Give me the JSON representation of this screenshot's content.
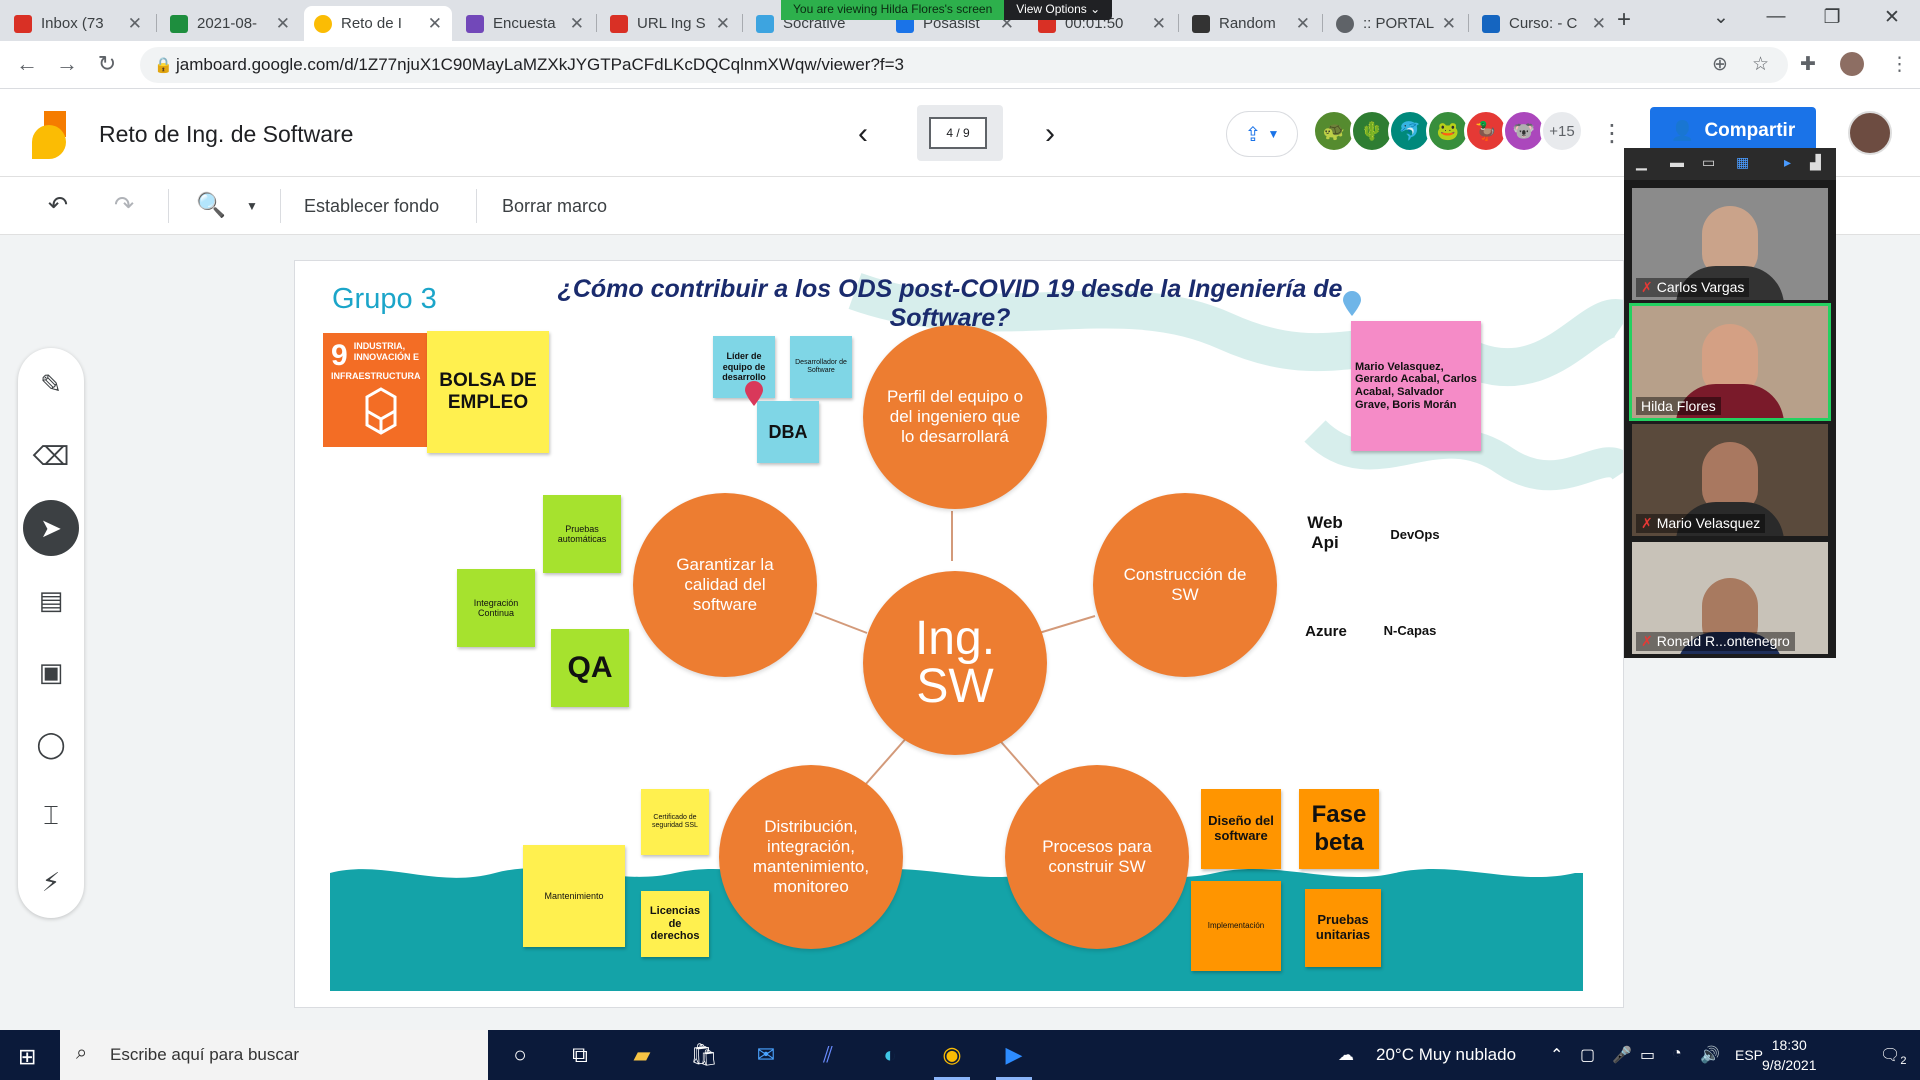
{
  "browser": {
    "tabs": [
      {
        "title": "Inbox (73",
        "color": "#d93025"
      },
      {
        "title": "2021-08-",
        "color": "#1e8e3e"
      },
      {
        "title": "Reto de I",
        "color": "#fbbc04"
      },
      {
        "title": "Encuesta",
        "color": "#7248b9"
      },
      {
        "title": "URL Ing S",
        "color": "#d93025"
      },
      {
        "title": "Socrative",
        "color": "#3da4e0"
      },
      {
        "title": "Posasist",
        "color": "#1a73e8"
      },
      {
        "title": "00:01:50",
        "color": "#d93025"
      },
      {
        "title": "Random",
        "color": "#333333"
      },
      {
        "title": ":: PORTAL",
        "color": "#5f6368"
      },
      {
        "title": "Curso: - C",
        "color": "#1565c0"
      }
    ],
    "screen_share_notice": "You are viewing Hilda Flores's screen",
    "view_options": "View Options",
    "url": "jamboard.google.com/d/1Z77njuX1C90MayLaMZXkJYGTPaCFdLKcDQCqlnmXWqw/viewer?f=3"
  },
  "app": {
    "title": "Reto de Ing. de Software",
    "frame_indicator": "4 / 9",
    "collaborators_more": "+15",
    "share_label": "Compartir",
    "accent": "#1a73e8"
  },
  "toolbar": {
    "set_background": "Establecer fondo",
    "clear_frame": "Borrar marco"
  },
  "canvas": {
    "title": "¿Cómo contribuir a los ODS post-COVID 19 desde la Ingeniería de Software?",
    "group": "Grupo 3",
    "sdg": {
      "number": "9",
      "label": "INDUSTRIA, INNOVACIÓN E INFRAESTRUCTURA"
    },
    "center": "Ing. SW",
    "circles": {
      "perfil": "Perfil del equipo o del ingeniero que lo desarrollará",
      "calidad": "Garantizar la calidad del software",
      "construccion": "Construcción de SW",
      "distribucion": "Distribución, integración, mantenimiento, monitoreo",
      "procesos": "Procesos para construir SW"
    },
    "notes": {
      "bolsa": "BOLSA DE EMPLEO",
      "lider": "Líder de equipo de desarrollo",
      "desarrollador": "Desarrollador de Software",
      "dba": "DBA",
      "team": "Mario Velasquez, Gerardo Acabal, Carlos Acabal, Salvador Grave, Boris Morán",
      "pruebas_auto": "Pruebas automáticas",
      "integracion": "Integración Continua",
      "qa": "QA",
      "certificado": "Certificado de seguridad SSL",
      "mantenimiento": "Mantenimiento",
      "licencias": "Licencias de derechos",
      "diseno": "Diseño del software",
      "fase_beta": "Fase beta",
      "implementacion": "Implementación",
      "pruebas_unit": "Pruebas unitarias"
    },
    "labels": {
      "web_api": "Web Api",
      "devops": "DevOps",
      "azure": "Azure",
      "ncapas": "N-Capas"
    }
  },
  "zoom": {
    "participants": [
      {
        "name": "Carlos Vargas",
        "muted": true
      },
      {
        "name": "Hilda Flores",
        "muted": false,
        "speaking": true
      },
      {
        "name": "Mario Velasquez",
        "muted": true
      },
      {
        "name": "Ronald R...ontenegro",
        "muted": true
      }
    ]
  },
  "taskbar": {
    "search_placeholder": "Escribe aquí para buscar",
    "weather": "20°C  Muy nublado",
    "language": "ESP",
    "time": "18:30",
    "date": "9/8/2021",
    "notifications": "2"
  }
}
